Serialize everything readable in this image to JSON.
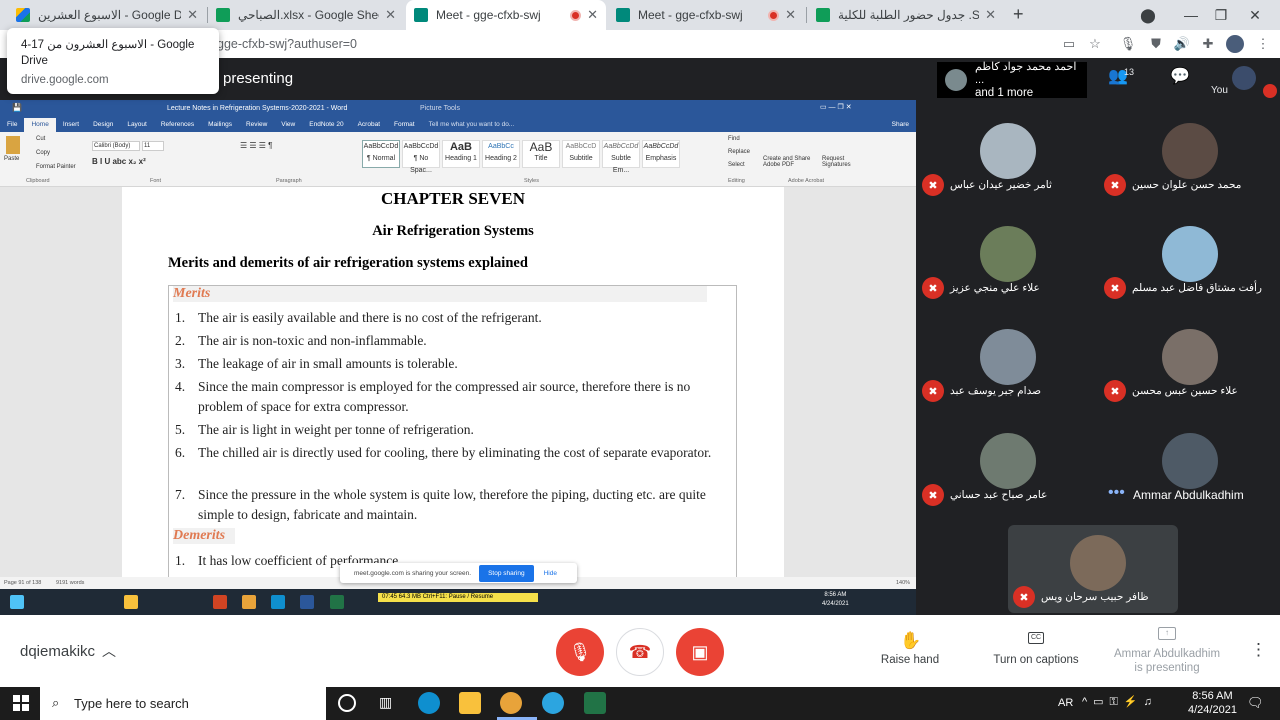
{
  "browser": {
    "tabs": [
      {
        "title": "الاسبوع العشرين - Google Drive",
        "icon": "google-drive-icon",
        "color": "#1a73e8"
      },
      {
        "title": "الصباحي.xlsx - Google Sheets",
        "icon": "google-sheets-icon",
        "color": "#0f9d58"
      },
      {
        "title": "Meet - gge-cfxb-swj",
        "icon": "google-meet-icon",
        "color": "#00897b",
        "active": true
      },
      {
        "title": "Meet - gge-cfxb-swj",
        "icon": "google-meet-icon",
        "color": "#00897b"
      },
      {
        "title": "جدول حضور الطلبة للكلية .Sheets",
        "icon": "google-sheets-icon",
        "color": "#0f9d58"
      }
    ],
    "new_tab": "+",
    "url": "gge-cfxb-swj?authuser=0",
    "tooltip": {
      "title": "الاسبوع العشرون من 17-4 - Google Drive",
      "domain": "drive.google.com"
    }
  },
  "meet": {
    "presenting": "presenting",
    "speaker": {
      "name": "احمد محمد جواد كاظم ...",
      "more": "and 1 more"
    },
    "people_count": "13",
    "you_label": "You",
    "meeting_code": "dqiemakikc",
    "controls": {
      "raise_hand": "Raise hand",
      "captions": "Turn on captions",
      "presenter_line1": "Ammar Abdulkadhim",
      "presenter_line2": "is presenting"
    },
    "participants": [
      {
        "name": "ثامر خضير عيدان عباس"
      },
      {
        "name": "محمد حسن علوان حسين"
      },
      {
        "name": "علاء علي منجي عزيز"
      },
      {
        "name": "رأفت مشتاق فاضل عبد مسلم"
      },
      {
        "name": "صدام جبر يوسف عبد"
      },
      {
        "name": "علاء حسين عبس محسن"
      },
      {
        "name": "عامر صباح عبد حساني"
      },
      {
        "name": "Ammar Abdulkadhim"
      },
      {
        "name": "ظافر حبيب سرحان ويس"
      }
    ]
  },
  "word": {
    "title": "Lecture Notes in Refrigeration Systems-2020-2021 - Word",
    "context_tab": "Picture Tools",
    "menu": [
      "File",
      "Home",
      "Insert",
      "Design",
      "Layout",
      "References",
      "Mailings",
      "Review",
      "View",
      "EndNote 20",
      "Acrobat",
      "Format"
    ],
    "tell_me": "Tell me what you want to do...",
    "share": "Share",
    "ribbon": {
      "clipboard": [
        "Paste",
        "Cut",
        "Copy",
        "Format Painter"
      ],
      "font_name": "Calibri (Body)",
      "font_size": "11",
      "styles": [
        {
          "sample": "AaBbCcDd",
          "name": "¶ Normal"
        },
        {
          "sample": "AaBbCcDd",
          "name": "¶ No Spac..."
        },
        {
          "sample": "AaB",
          "name": "Heading 1"
        },
        {
          "sample": "AaBbCc",
          "name": "Heading 2"
        },
        {
          "sample": "AaB",
          "name": "Title"
        },
        {
          "sample": "AaBbCcD",
          "name": "Subtitle"
        },
        {
          "sample": "AaBbCcDd",
          "name": "Subtle Em..."
        },
        {
          "sample": "AaBbCcDd",
          "name": "Emphasis"
        }
      ],
      "editing": [
        "Find",
        "Replace",
        "Select"
      ],
      "adobe": [
        "Create and Share Adobe PDF",
        "Request Signatures"
      ],
      "groups": [
        "Clipboard",
        "Font",
        "Paragraph",
        "Styles",
        "Editing",
        "Adobe Acrobat"
      ]
    },
    "doc": {
      "chapter": "CHAPTER SEVEN",
      "subtitle": "Air Refrigeration Systems",
      "heading": "Merits and demerits of air refrigeration systems explained",
      "merits_label": "Merits",
      "merits": [
        "The air is easily available and there is no cost of the refrigerant.",
        "The air is non-toxic and non-inflammable.",
        "The leakage of air in small amounts is tolerable.",
        "Since the main compressor is employed for the compressed air source, therefore there is no problem of space for extra compressor.",
        "The air is light in weight per tonne of refrigeration.",
        "The chilled air is directly used for cooling, there by eliminating the cost of separate evaporator.",
        "Since the pressure in the whole system is quite low, therefore the piping, ducting etc. are quite simple to design, fabricate and maintain."
      ],
      "demerits_label": "Demerits",
      "demerits": [
        "It has low coefficient of performance."
      ]
    },
    "status": {
      "page": "Page 91 of 138",
      "words": "9191 words",
      "zoom": "140%"
    },
    "share_notice": "meet.google.com is sharing your screen.",
    "stop_sharing": "Stop sharing",
    "hide": "Hide",
    "recorder": "07:45   64.3 MB   Ctrl+F11: Pause / Resume",
    "inner_clock": {
      "time": "8:56 AM",
      "date": "4/24/2021"
    }
  },
  "taskbar": {
    "search": "Type here to search",
    "lang": "AR",
    "time": "8:56 AM",
    "date": "4/24/2021"
  }
}
